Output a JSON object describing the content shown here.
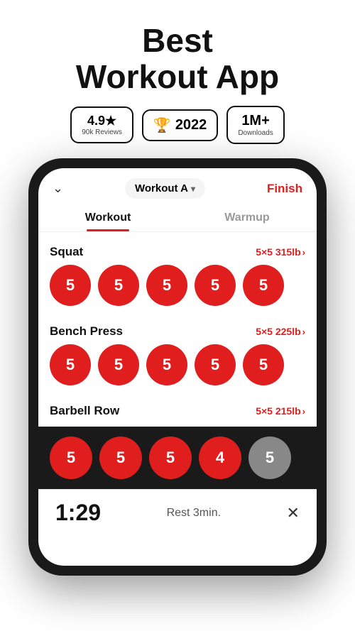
{
  "header": {
    "title_line1": "Best",
    "title_line2": "Workout App"
  },
  "badges": [
    {
      "id": "rating",
      "main": "4.9★",
      "sub": "90k Reviews"
    },
    {
      "id": "award",
      "icon": "🏆",
      "year": "2022"
    },
    {
      "id": "downloads",
      "main": "1M+",
      "sub": "Downloads"
    }
  ],
  "phone": {
    "workout_selector": "Workout A",
    "finish_button": "Finish",
    "tabs": [
      {
        "label": "Workout",
        "active": true
      },
      {
        "label": "Warmup",
        "active": false
      }
    ],
    "exercises": [
      {
        "name": "Squat",
        "sets_info": "5×5 315lb",
        "reps": [
          5,
          5,
          5,
          5,
          5
        ],
        "grey": []
      },
      {
        "name": "Bench Press",
        "sets_info": "5×5 225lb",
        "reps": [
          5,
          5,
          5,
          5,
          5
        ],
        "grey": []
      },
      {
        "name": "Barbell Row",
        "sets_info": "5×5 215lb",
        "reps": [
          5,
          5,
          5,
          4,
          5
        ],
        "grey": [
          4
        ]
      }
    ],
    "bottom_reps": [
      5,
      5,
      5,
      4,
      5
    ],
    "bottom_grey": [
      4
    ],
    "rest_timer": {
      "time": "1:29",
      "label": "Rest 3min."
    }
  },
  "icons": {
    "chevron_down": "⌄",
    "caret": "▾",
    "arrow_right": "›",
    "close": "✕"
  }
}
